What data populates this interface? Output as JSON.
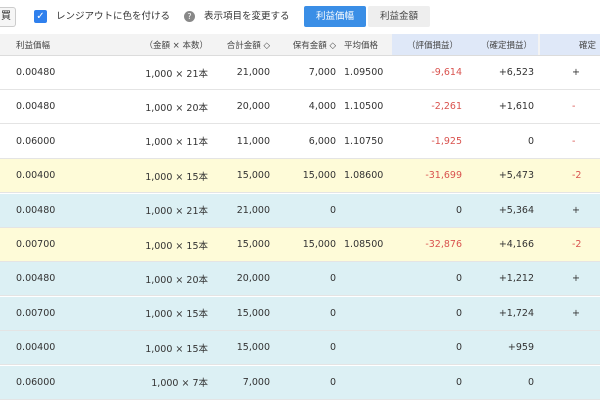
{
  "toolbar": {
    "cut_label": "買",
    "checkbox_checked": true,
    "checkbox_label": "レンジアウトに色を付ける",
    "change_items_label": "表示項目を変更する",
    "btn_profit_width": "利益価幅",
    "btn_profit_amount": "利益金額"
  },
  "colors": {
    "accent": "#3a8ee6",
    "negative": "#d9534f",
    "row_highlight_yellow": "#fefbd8",
    "row_highlight_teal": "#dcf0f4",
    "header_highlight": "#dfe8f8"
  },
  "table": {
    "headers": [
      "利益価幅",
      "（金額 × 本数）",
      "合計金額 ◇",
      "保有金額 ◇",
      "平均価格",
      "（評価損益）",
      "（確定損益）",
      "確定"
    ],
    "rows": [
      {
        "c": [
          "0.00480",
          "1,000 × 21本",
          "21,000",
          "7,000",
          "1.09500",
          "-9,614",
          "+6,523",
          "+"
        ],
        "tint": "none",
        "neg5": true
      },
      {
        "c": [
          "0.00480",
          "1,000 × 20本",
          "20,000",
          "4,000",
          "1.10500",
          "-2,261",
          "+1,610",
          "-"
        ],
        "tint": "none",
        "neg5": true
      },
      {
        "c": [
          "0.06000",
          "1,000 × 11本",
          "11,000",
          "6,000",
          "1.10750",
          "-1,925",
          "0",
          "-"
        ],
        "tint": "none",
        "neg5": true
      },
      {
        "c": [
          "0.00400",
          "1,000 × 15本",
          "15,000",
          "15,000",
          "1.08600",
          "-31,699",
          "+5,473",
          "-2"
        ],
        "tint": "yellow",
        "neg5": true
      },
      {
        "c": [
          "0.00480",
          "1,000 × 21本",
          "21,000",
          "0",
          "",
          "0",
          "+5,364",
          "+"
        ],
        "tint": "teal",
        "neg5": false
      },
      {
        "c": [
          "0.00700",
          "1,000 × 15本",
          "15,000",
          "15,000",
          "1.08500",
          "-32,876",
          "+4,166",
          "-2"
        ],
        "tint": "yellow",
        "neg5": true
      },
      {
        "c": [
          "0.00480",
          "1,000 × 20本",
          "20,000",
          "0",
          "",
          "0",
          "+1,212",
          "+"
        ],
        "tint": "teal",
        "neg5": false
      },
      {
        "c": [
          "0.00700",
          "1,000 × 15本",
          "15,000",
          "0",
          "",
          "0",
          "+1,724",
          "+"
        ],
        "tint": "teal",
        "neg5": false
      },
      {
        "c": [
          "0.00400",
          "1,000 × 15本",
          "15,000",
          "0",
          "",
          "0",
          "+959",
          ""
        ],
        "tint": "teal",
        "neg5": false
      },
      {
        "c": [
          "0.06000",
          "1,000 × 7本",
          "7,000",
          "0",
          "",
          "0",
          "0",
          ""
        ],
        "tint": "teal",
        "neg5": false
      }
    ]
  }
}
